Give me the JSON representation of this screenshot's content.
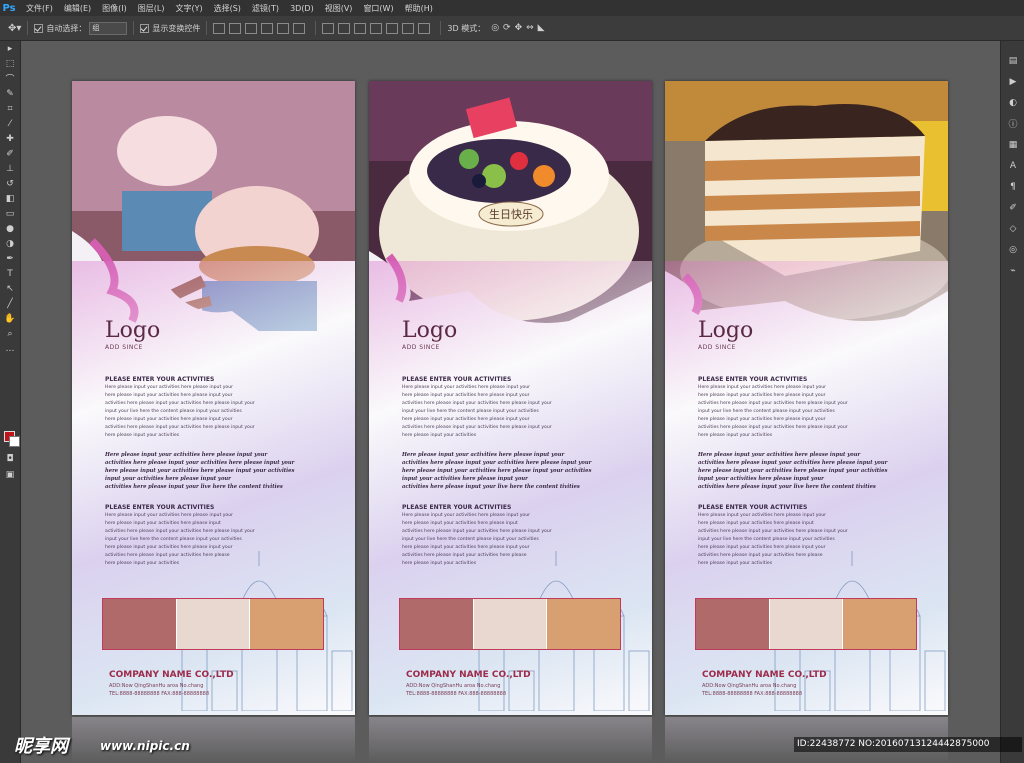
{
  "app": {
    "logo": "Ps"
  },
  "menu": [
    "文件(F)",
    "编辑(E)",
    "图像(I)",
    "图层(L)",
    "文字(Y)",
    "选择(S)",
    "滤镜(T)",
    "3D(D)",
    "视图(V)",
    "窗口(W)",
    "帮助(H)"
  ],
  "options": {
    "auto_select_label": "自动选择：",
    "auto_select_value": "组",
    "show_transform_label": "显示变换控件",
    "mode_3d_label": "3D 模式："
  },
  "poster": {
    "logo": "Logo",
    "logo_sub": "ADD SINCE",
    "heading1": "PLEASE ENTER YOUR ACTIVITIES",
    "body1": [
      "Here please input your activities here please input your",
      "here please input your activities here please input your",
      "activities here please input your activities here please input your",
      "input your live here the content please input your activities",
      "here please input your activities here please input your",
      "activities here please input your activities here please input your",
      "here please input your activities"
    ],
    "script": [
      "Here please input your activities here please input your",
      "activities here please input your activities here please input your",
      "here please input your activities here please input your activities",
      "input your activities here please input your",
      "activities here please input your live here the content tivities"
    ],
    "heading2": "PLEASE ENTER YOUR ACTIVITIES",
    "body2": [
      "Here please input your activities here please input your",
      "here please input your activities here please input",
      "activities here please input your activities here please input your",
      "input your live here the content please input your activities",
      "here please input your activities here please input your",
      "activities here please input your activities here please",
      "here please input your activities"
    ],
    "company": "COMPANY NAME CO.,LTD",
    "address": "ADD:Now QingShanHu aroa No.chang",
    "tel": "TEL:8888-88888888   FAX:888-88888888"
  },
  "watermark": {
    "logo": "昵享网",
    "url": "www.nipic.cn",
    "id": "ID:22438772 NO:20160713124442875000"
  }
}
